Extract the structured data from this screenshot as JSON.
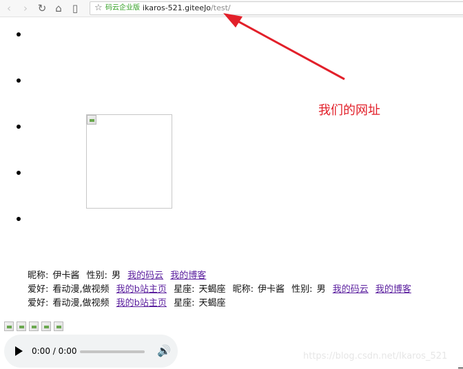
{
  "browser": {
    "back_icon": "‹",
    "forward_icon": "›",
    "reload_icon": "↻",
    "home_icon": "⌂",
    "reader_icon": "▯",
    "star_icon": "☆",
    "site_name": "码云企业版",
    "url_host": "ikaros-521.giteeJo",
    "url_path": "/test/"
  },
  "annotation": {
    "label": "我们的网址",
    "color": "#e2202a"
  },
  "info": {
    "nickname_label": "昵称:",
    "nickname": "伊卡酱",
    "gender_label": "性别:",
    "gender": "男",
    "link_gitee": "我的码云",
    "link_blog": "我的博客",
    "hobby_label": "爱好:",
    "hobby": "看动漫,做视频",
    "link_bili": "我的b站主页",
    "zodiac_label": "星座:",
    "zodiac": "天蝎座"
  },
  "audio": {
    "time": "0:00 / 0:00",
    "progress": 0,
    "volume_icon": "🔊"
  },
  "watermark": "https://blog.csdn.net/Ikaros_521"
}
